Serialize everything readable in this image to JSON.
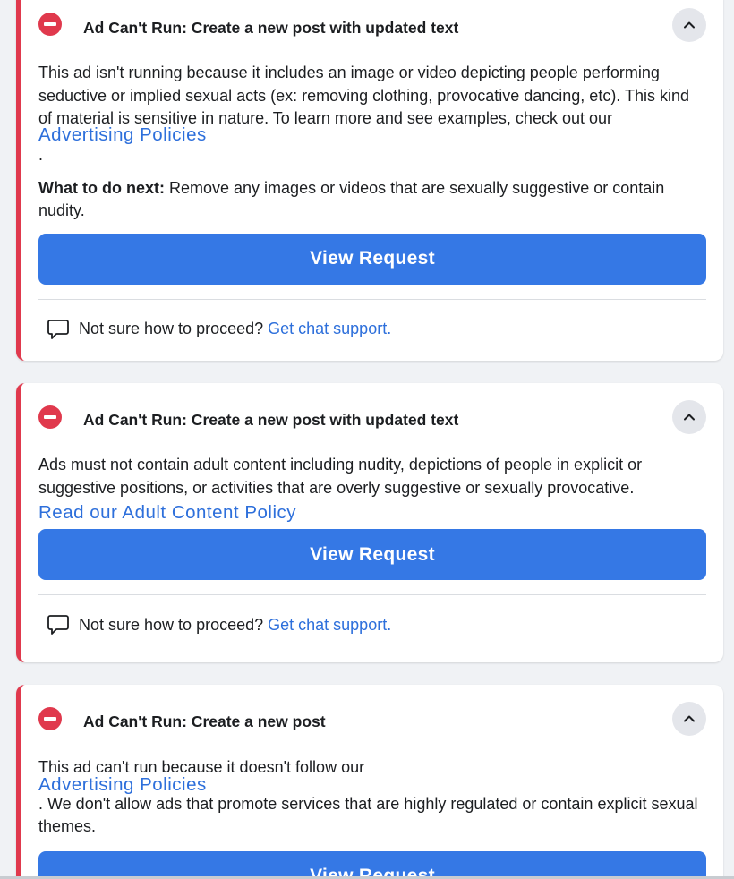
{
  "cards": [
    {
      "title": "Ad Can't Run: Create a new post with updated text",
      "body": "This ad isn't running because it includes an image or video depicting people performing seductive or implied sexual acts (ex: removing clothing, provocative dancing, etc). This kind of material is sensitive in nature. To learn more and see examples, check out our",
      "link": "Advertising Policies",
      "after_link": ".",
      "next_label": "What to do next:",
      "next_text": "Remove any images or videos that are sexually suggestive or contain nudity.",
      "button": "View Request",
      "support_text": "Not sure how to proceed?",
      "support_link": "Get chat support."
    },
    {
      "title": "Ad Can't Run: Create a new post with updated text",
      "body": "Ads must not contain adult content including nudity, depictions of people in explicit or suggestive positions, or activities that are overly suggestive or sexually provocative.",
      "link": "Read our Adult Content Policy",
      "button": "View Request",
      "support_text": "Not sure how to proceed?",
      "support_link": "Get chat support."
    },
    {
      "title": "Ad Can't Run: Create a new post",
      "body": "This ad can't run because it doesn't follow our",
      "link": "Advertising Policies",
      "after_link": ". We don't allow ads that promote services that are highly regulated or contain explicit sexual themes.",
      "button": "View Request"
    }
  ],
  "colors": {
    "alert_red": "#e0394d",
    "primary_blue": "#3578e5",
    "link_blue": "#2d6fdb"
  },
  "icons": {
    "alert": "stop-sign-icon",
    "collapse": "chevron-up-icon",
    "chat": "chat-bubble-icon"
  }
}
